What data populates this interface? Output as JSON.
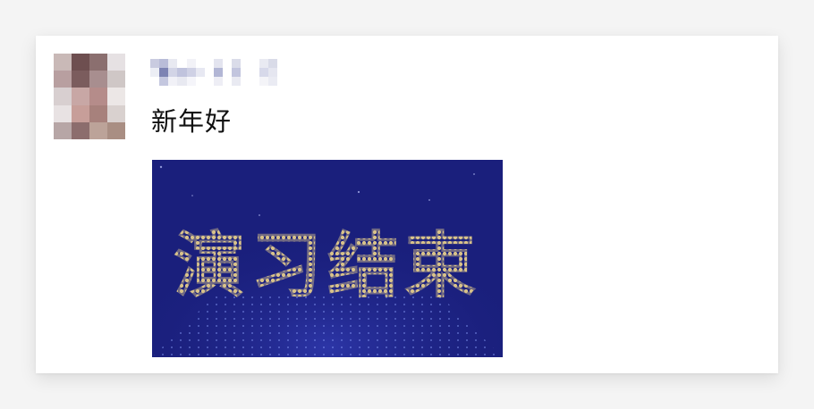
{
  "post": {
    "message": "新年好",
    "image_text": "演习结束"
  },
  "colors": {
    "image_background": "#1a1f7c",
    "dot_text": "#d9c38a",
    "text": "#111111"
  }
}
